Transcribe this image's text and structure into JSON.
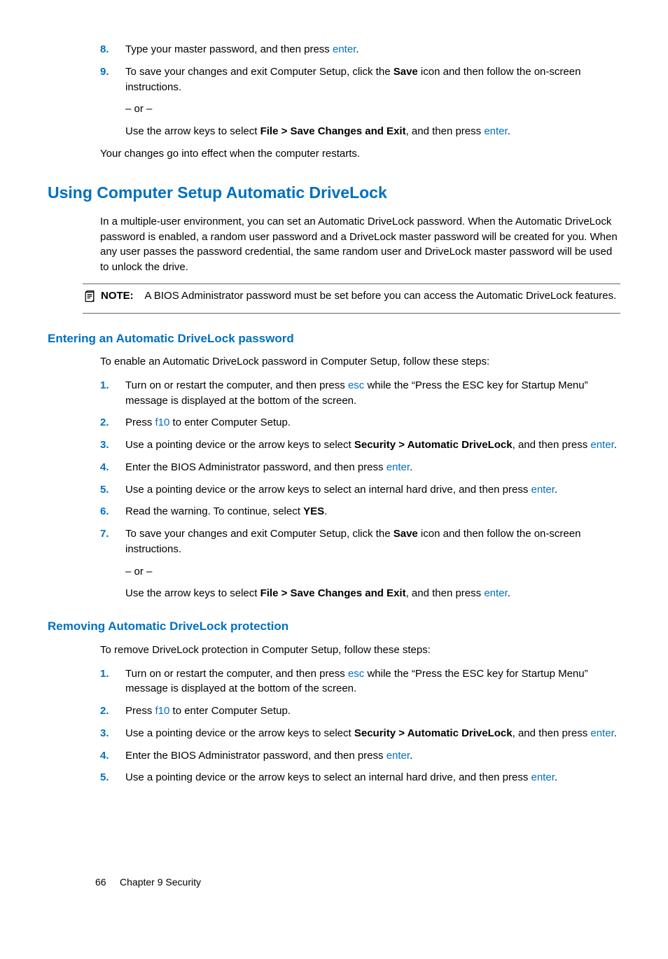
{
  "top_steps": [
    {
      "num": "8.",
      "parts": [
        {
          "t": "Type your master password, and then press "
        },
        {
          "t": "enter",
          "cls": "key"
        },
        {
          "t": "."
        }
      ]
    },
    {
      "num": "9.",
      "parts": [
        {
          "t": "To save your changes and exit Computer Setup, click the "
        },
        {
          "t": "Save",
          "cls": "bold"
        },
        {
          "t": " icon and then follow the on-screen instructions."
        }
      ],
      "subs": [
        [
          {
            "t": "– or –"
          }
        ],
        [
          {
            "t": "Use the arrow keys to select "
          },
          {
            "t": "File > Save Changes and Exit",
            "cls": "bold"
          },
          {
            "t": ", and then press "
          },
          {
            "t": "enter",
            "cls": "key"
          },
          {
            "t": "."
          }
        ]
      ]
    }
  ],
  "top_after": "Your changes go into effect when the computer restarts.",
  "h2": "Using Computer Setup Automatic DriveLock",
  "intro": "In a multiple-user environment, you can set an Automatic DriveLock password. When the Automatic DriveLock password is enabled, a random user password and a DriveLock master password will be created for you. When any user passes the password credential, the same random user and DriveLock master password will be used to unlock the drive.",
  "note_label": "NOTE:",
  "note_body": "A BIOS Administrator password must be set before you can access the Automatic DriveLock features.",
  "h3a": "Entering an Automatic DriveLock password",
  "para_a": "To enable an Automatic DriveLock password in Computer Setup, follow these steps:",
  "steps_a": [
    {
      "num": "1.",
      "parts": [
        {
          "t": "Turn on or restart the computer, and then press "
        },
        {
          "t": "esc",
          "cls": "key"
        },
        {
          "t": " while the “Press the ESC key for Startup Menu” message is displayed at the bottom of the screen."
        }
      ]
    },
    {
      "num": "2.",
      "parts": [
        {
          "t": "Press "
        },
        {
          "t": "f10",
          "cls": "key"
        },
        {
          "t": " to enter Computer Setup."
        }
      ]
    },
    {
      "num": "3.",
      "parts": [
        {
          "t": "Use a pointing device or the arrow keys to select "
        },
        {
          "t": "Security > Automatic DriveLock",
          "cls": "bold"
        },
        {
          "t": ", and then press "
        },
        {
          "t": "enter",
          "cls": "key"
        },
        {
          "t": "."
        }
      ]
    },
    {
      "num": "4.",
      "parts": [
        {
          "t": "Enter the BIOS Administrator password, and then press "
        },
        {
          "t": "enter",
          "cls": "key"
        },
        {
          "t": "."
        }
      ]
    },
    {
      "num": "5.",
      "parts": [
        {
          "t": "Use a pointing device or the arrow keys to select an internal hard drive, and then press "
        },
        {
          "t": "enter",
          "cls": "key"
        },
        {
          "t": "."
        }
      ]
    },
    {
      "num": "6.",
      "parts": [
        {
          "t": "Read the warning. To continue, select "
        },
        {
          "t": "YES",
          "cls": "bold"
        },
        {
          "t": "."
        }
      ]
    },
    {
      "num": "7.",
      "parts": [
        {
          "t": "To save your changes and exit Computer Setup, click the "
        },
        {
          "t": "Save",
          "cls": "bold"
        },
        {
          "t": " icon and then follow the on-screen instructions."
        }
      ],
      "subs": [
        [
          {
            "t": "– or –"
          }
        ],
        [
          {
            "t": "Use the arrow keys to select "
          },
          {
            "t": "File > Save Changes and Exit",
            "cls": "bold"
          },
          {
            "t": ", and then press "
          },
          {
            "t": "enter",
            "cls": "key"
          },
          {
            "t": "."
          }
        ]
      ]
    }
  ],
  "h3b": "Removing Automatic DriveLock protection",
  "para_b": "To remove DriveLock protection in Computer Setup, follow these steps:",
  "steps_b": [
    {
      "num": "1.",
      "parts": [
        {
          "t": "Turn on or restart the computer, and then press "
        },
        {
          "t": "esc",
          "cls": "key"
        },
        {
          "t": " while the “Press the ESC key for Startup Menu” message is displayed at the bottom of the screen."
        }
      ]
    },
    {
      "num": "2.",
      "parts": [
        {
          "t": "Press "
        },
        {
          "t": "f10",
          "cls": "key"
        },
        {
          "t": " to enter Computer Setup."
        }
      ]
    },
    {
      "num": "3.",
      "parts": [
        {
          "t": "Use a pointing device or the arrow keys to select "
        },
        {
          "t": "Security > Automatic DriveLock",
          "cls": "bold"
        },
        {
          "t": ", and then press "
        },
        {
          "t": "enter",
          "cls": "key"
        },
        {
          "t": "."
        }
      ]
    },
    {
      "num": "4.",
      "parts": [
        {
          "t": "Enter the BIOS Administrator password, and then press "
        },
        {
          "t": "enter",
          "cls": "key"
        },
        {
          "t": "."
        }
      ]
    },
    {
      "num": "5.",
      "parts": [
        {
          "t": "Use a pointing device or the arrow keys to select an internal hard drive, and then press "
        },
        {
          "t": "enter",
          "cls": "key"
        },
        {
          "t": "."
        }
      ]
    }
  ],
  "footer_page": "66",
  "footer_chapter": "Chapter 9   Security"
}
